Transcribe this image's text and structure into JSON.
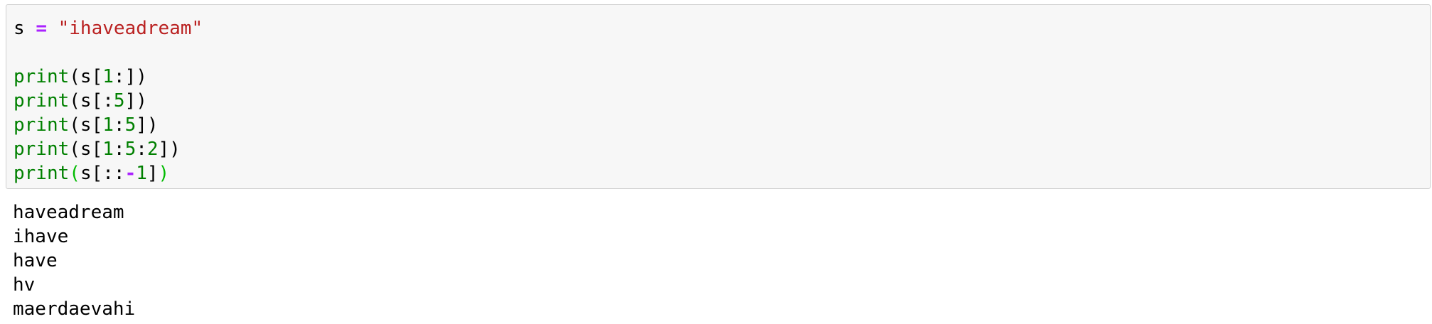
{
  "code": {
    "line1": {
      "var": "s",
      "assign": "=",
      "string": "\"ihaveadream\""
    },
    "line3": {
      "func": "print",
      "open": "(s[",
      "num1": "1",
      "colon": ":",
      "close": "])"
    },
    "line4": {
      "func": "print",
      "open": "(s[",
      "colon": ":",
      "num1": "5",
      "close": "])"
    },
    "line5": {
      "func": "print",
      "open": "(s[",
      "num1": "1",
      "colon": ":",
      "num2": "5",
      "close": "])"
    },
    "line6": {
      "func": "print",
      "open": "(s[",
      "num1": "1",
      "colon1": ":",
      "num2": "5",
      "colon2": ":",
      "num3": "2",
      "close": "])"
    },
    "line7": {
      "func": "print",
      "paren_open": "(",
      "var": "s[",
      "colons": "::",
      "minus": "-",
      "num1": "1",
      "bracket_close": "]",
      "paren_close": ")"
    }
  },
  "output": {
    "lines": [
      "haveadream",
      "ihave",
      "have",
      "hv",
      "maerdaevahi"
    ]
  },
  "colors": {
    "keyword": "#008000",
    "operator": "#aa22ff",
    "string": "#ba2121",
    "number": "#008000",
    "matched_paren": "#00bb00",
    "cell_background": "#f7f7f7",
    "cell_border": "#cfcfcf"
  }
}
